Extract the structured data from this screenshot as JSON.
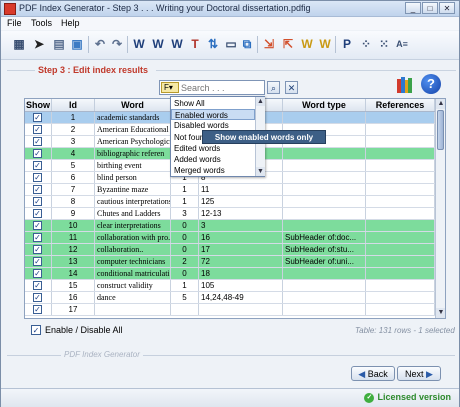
{
  "window": {
    "title": "PDF Index Generator - Step 3 . . . Writing your Doctoral dissertation.pdfig",
    "controls": [
      "_",
      "□",
      "✕"
    ]
  },
  "menu": [
    "File",
    "Tools",
    "Help"
  ],
  "toolbar": {
    "icons": [
      "grid-icon",
      "cursor-icon",
      "print-icon",
      "export-icon",
      "undo-icon",
      "redo-icon",
      "word-w-icon",
      "word-w-edit-icon",
      "word-w-add-icon",
      "text-size-icon",
      "merge-icon",
      "window-icon",
      "duplicate-icon",
      "subheader-icon",
      "copy-words-icon",
      "crown-w-icon",
      "crown-w-alt-icon",
      "paragraph-icon",
      "split-icon",
      "join-icon",
      "abc-icon"
    ]
  },
  "step": {
    "title": "Step 3 : Edit index results"
  },
  "search": {
    "placeholder": "Search . . .",
    "filter_label": "F"
  },
  "table": {
    "columns": [
      "Show",
      "Id",
      "Word",
      "",
      "",
      "Word type",
      "References"
    ],
    "rows": [
      {
        "show": true,
        "id": "1",
        "word": "academic standards",
        "count": "",
        "pages": "",
        "type": "",
        "refs": "",
        "style": "selected"
      },
      {
        "show": true,
        "id": "2",
        "word": "American Educational",
        "count": "",
        "pages": "",
        "type": "",
        "refs": "",
        "style": "white"
      },
      {
        "show": true,
        "id": "3",
        "word": "American Psychologic",
        "count": "",
        "pages": "",
        "type": "",
        "refs": "",
        "style": "white"
      },
      {
        "show": true,
        "id": "4",
        "word": "bibliographic referen",
        "count": "",
        "pages": "",
        "type": "",
        "refs": "",
        "style": "green"
      },
      {
        "show": true,
        "id": "5",
        "word": "birthing event",
        "count": "",
        "pages": "",
        "type": "",
        "refs": "",
        "style": "white"
      },
      {
        "show": true,
        "id": "6",
        "word": "blind person",
        "count": "1",
        "pages": "8",
        "type": "",
        "refs": "",
        "style": "white"
      },
      {
        "show": true,
        "id": "7",
        "word": "Byzantine maze",
        "count": "1",
        "pages": "11",
        "type": "",
        "refs": "",
        "style": "white"
      },
      {
        "show": true,
        "id": "8",
        "word": "cautious interpretations",
        "count": "1",
        "pages": "125",
        "type": "",
        "refs": "",
        "style": "white"
      },
      {
        "show": true,
        "id": "9",
        "word": "Chutes and Ladders",
        "count": "3",
        "pages": "12-13",
        "type": "",
        "refs": "",
        "style": "white"
      },
      {
        "show": true,
        "id": "10",
        "word": "clear interpretations",
        "count": "0",
        "pages": "3",
        "type": "",
        "refs": "",
        "style": "green"
      },
      {
        "show": true,
        "id": "11",
        "word": "collaboration with pro...",
        "count": "0",
        "pages": "16",
        "type": "SubHeader of:doc...",
        "refs": "",
        "style": "green"
      },
      {
        "show": true,
        "id": "12",
        "word": "collaboration..",
        "count": "0",
        "pages": "17",
        "type": "SubHeader of:stu...",
        "refs": "",
        "style": "green"
      },
      {
        "show": true,
        "id": "13",
        "word": "computer technicians",
        "count": "2",
        "pages": "72",
        "type": "SubHeader of:uni...",
        "refs": "",
        "style": "green"
      },
      {
        "show": true,
        "id": "14",
        "word": "conditional matriculati...",
        "count": "0",
        "pages": "18",
        "type": "",
        "refs": "",
        "style": "green"
      },
      {
        "show": true,
        "id": "15",
        "word": "construct validity",
        "count": "1",
        "pages": "105",
        "type": "",
        "refs": "",
        "style": "white"
      },
      {
        "show": true,
        "id": "16",
        "word": "dance",
        "count": "5",
        "pages": "14,24,48-49",
        "type": "",
        "refs": "",
        "style": "white"
      },
      {
        "show": true,
        "id": "17",
        "word": "",
        "count": "",
        "pages": "",
        "type": "",
        "refs": "",
        "style": "white"
      }
    ]
  },
  "filter_menu": {
    "items": [
      "Show All",
      "Enabled words",
      "Disabled words",
      "Not found",
      "Edited words",
      "Added words",
      "Merged words"
    ],
    "checked_index": 1,
    "tooltip": "Show enabled words only"
  },
  "enable_all": {
    "label": "Enable / Disable All",
    "checked": true
  },
  "table_status": "Table: 131 rows - 1 selected",
  "footer": {
    "label": "PDF Index Generator"
  },
  "nav": {
    "back": "Back",
    "next": "Next"
  },
  "status": {
    "license": "Licensed version"
  },
  "colors": {
    "green_row": "#7ddc9c",
    "selected_row": "#a9cdee",
    "accent_red": "#c0392b",
    "license_green": "#2d8a2d"
  }
}
